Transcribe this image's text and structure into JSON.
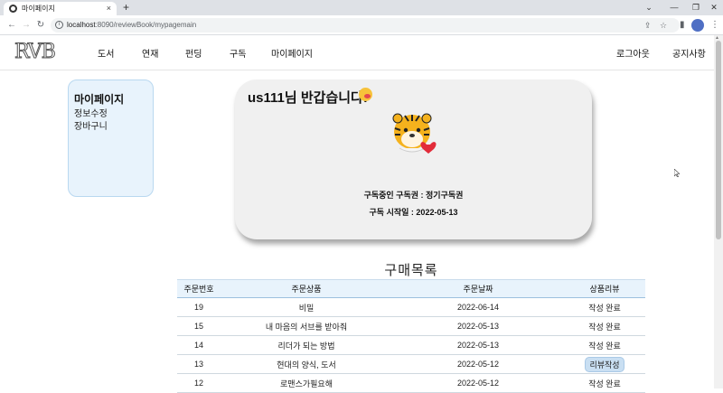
{
  "browser": {
    "tab_title": "마이페이지",
    "url_host": "localhost",
    "url_path": ":8090/reviewBook/mypagemain",
    "new_tab": "+",
    "tab_close": "×"
  },
  "site": {
    "logo": "RVB",
    "nav": [
      "도서",
      "연재",
      "펀딩",
      "구독",
      "마이페이지"
    ],
    "logout": "로그아웃",
    "notice": "공지사항"
  },
  "sidebar": {
    "title": "마이페이지",
    "links": [
      "정보수정",
      "장바구니"
    ]
  },
  "profile": {
    "greeting": "us111님 반갑습니다!",
    "subscription_label": "구독중인 구독권 : 정기구독권",
    "start_label": "구독 시작일 : 2022-05-13"
  },
  "orders": {
    "title": "구매목록",
    "columns": [
      "주문번호",
      "주문상품",
      "주문날짜",
      "상품리뷰"
    ],
    "rows": [
      {
        "id": "19",
        "product": "비밀",
        "date": "2022-06-14",
        "review": "작성 완료",
        "is_button": false
      },
      {
        "id": "15",
        "product": "내 마음의 서브를 받아줘",
        "date": "2022-05-13",
        "review": "작성 완료",
        "is_button": false
      },
      {
        "id": "14",
        "product": "리더가 되는 방법",
        "date": "2022-05-13",
        "review": "작성 완료",
        "is_button": false
      },
      {
        "id": "13",
        "product": "현대의 양식, 도서",
        "date": "2022-05-12",
        "review": "리뷰작성",
        "is_button": true
      },
      {
        "id": "12",
        "product": "로맨스가필요해",
        "date": "2022-05-12",
        "review": "작성 완료",
        "is_button": false
      }
    ]
  },
  "colors": {
    "accent_light": "#e8f3fc",
    "card_bg": "#f0f0f0"
  }
}
